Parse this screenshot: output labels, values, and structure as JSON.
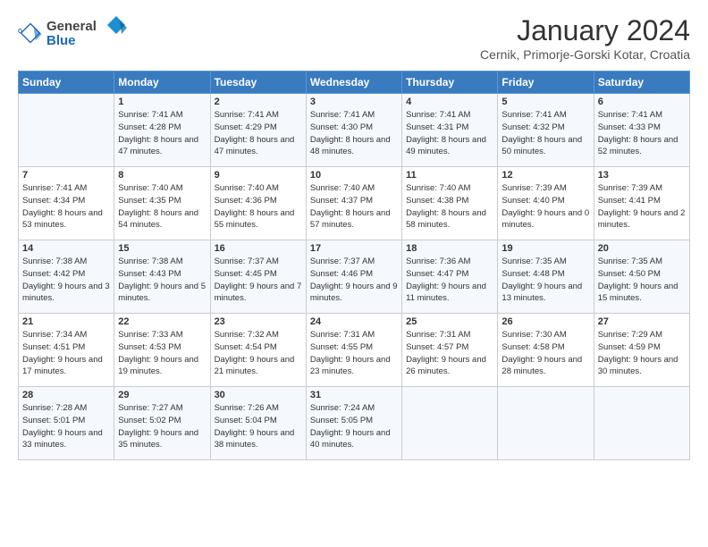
{
  "header": {
    "logo_general": "General",
    "logo_blue": "Blue",
    "title": "January 2024",
    "location": "Cernik, Primorje-Gorski Kotar, Croatia"
  },
  "days_of_week": [
    "Sunday",
    "Monday",
    "Tuesday",
    "Wednesday",
    "Thursday",
    "Friday",
    "Saturday"
  ],
  "weeks": [
    [
      {
        "day": "",
        "sunrise": "",
        "sunset": "",
        "daylight": ""
      },
      {
        "day": "1",
        "sunrise": "Sunrise: 7:41 AM",
        "sunset": "Sunset: 4:28 PM",
        "daylight": "Daylight: 8 hours and 47 minutes."
      },
      {
        "day": "2",
        "sunrise": "Sunrise: 7:41 AM",
        "sunset": "Sunset: 4:29 PM",
        "daylight": "Daylight: 8 hours and 47 minutes."
      },
      {
        "day": "3",
        "sunrise": "Sunrise: 7:41 AM",
        "sunset": "Sunset: 4:30 PM",
        "daylight": "Daylight: 8 hours and 48 minutes."
      },
      {
        "day": "4",
        "sunrise": "Sunrise: 7:41 AM",
        "sunset": "Sunset: 4:31 PM",
        "daylight": "Daylight: 8 hours and 49 minutes."
      },
      {
        "day": "5",
        "sunrise": "Sunrise: 7:41 AM",
        "sunset": "Sunset: 4:32 PM",
        "daylight": "Daylight: 8 hours and 50 minutes."
      },
      {
        "day": "6",
        "sunrise": "Sunrise: 7:41 AM",
        "sunset": "Sunset: 4:33 PM",
        "daylight": "Daylight: 8 hours and 52 minutes."
      }
    ],
    [
      {
        "day": "7",
        "sunrise": "Sunrise: 7:41 AM",
        "sunset": "Sunset: 4:34 PM",
        "daylight": "Daylight: 8 hours and 53 minutes."
      },
      {
        "day": "8",
        "sunrise": "Sunrise: 7:40 AM",
        "sunset": "Sunset: 4:35 PM",
        "daylight": "Daylight: 8 hours and 54 minutes."
      },
      {
        "day": "9",
        "sunrise": "Sunrise: 7:40 AM",
        "sunset": "Sunset: 4:36 PM",
        "daylight": "Daylight: 8 hours and 55 minutes."
      },
      {
        "day": "10",
        "sunrise": "Sunrise: 7:40 AM",
        "sunset": "Sunset: 4:37 PM",
        "daylight": "Daylight: 8 hours and 57 minutes."
      },
      {
        "day": "11",
        "sunrise": "Sunrise: 7:40 AM",
        "sunset": "Sunset: 4:38 PM",
        "daylight": "Daylight: 8 hours and 58 minutes."
      },
      {
        "day": "12",
        "sunrise": "Sunrise: 7:39 AM",
        "sunset": "Sunset: 4:40 PM",
        "daylight": "Daylight: 9 hours and 0 minutes."
      },
      {
        "day": "13",
        "sunrise": "Sunrise: 7:39 AM",
        "sunset": "Sunset: 4:41 PM",
        "daylight": "Daylight: 9 hours and 2 minutes."
      }
    ],
    [
      {
        "day": "14",
        "sunrise": "Sunrise: 7:38 AM",
        "sunset": "Sunset: 4:42 PM",
        "daylight": "Daylight: 9 hours and 3 minutes."
      },
      {
        "day": "15",
        "sunrise": "Sunrise: 7:38 AM",
        "sunset": "Sunset: 4:43 PM",
        "daylight": "Daylight: 9 hours and 5 minutes."
      },
      {
        "day": "16",
        "sunrise": "Sunrise: 7:37 AM",
        "sunset": "Sunset: 4:45 PM",
        "daylight": "Daylight: 9 hours and 7 minutes."
      },
      {
        "day": "17",
        "sunrise": "Sunrise: 7:37 AM",
        "sunset": "Sunset: 4:46 PM",
        "daylight": "Daylight: 9 hours and 9 minutes."
      },
      {
        "day": "18",
        "sunrise": "Sunrise: 7:36 AM",
        "sunset": "Sunset: 4:47 PM",
        "daylight": "Daylight: 9 hours and 11 minutes."
      },
      {
        "day": "19",
        "sunrise": "Sunrise: 7:35 AM",
        "sunset": "Sunset: 4:48 PM",
        "daylight": "Daylight: 9 hours and 13 minutes."
      },
      {
        "day": "20",
        "sunrise": "Sunrise: 7:35 AM",
        "sunset": "Sunset: 4:50 PM",
        "daylight": "Daylight: 9 hours and 15 minutes."
      }
    ],
    [
      {
        "day": "21",
        "sunrise": "Sunrise: 7:34 AM",
        "sunset": "Sunset: 4:51 PM",
        "daylight": "Daylight: 9 hours and 17 minutes."
      },
      {
        "day": "22",
        "sunrise": "Sunrise: 7:33 AM",
        "sunset": "Sunset: 4:53 PM",
        "daylight": "Daylight: 9 hours and 19 minutes."
      },
      {
        "day": "23",
        "sunrise": "Sunrise: 7:32 AM",
        "sunset": "Sunset: 4:54 PM",
        "daylight": "Daylight: 9 hours and 21 minutes."
      },
      {
        "day": "24",
        "sunrise": "Sunrise: 7:31 AM",
        "sunset": "Sunset: 4:55 PM",
        "daylight": "Daylight: 9 hours and 23 minutes."
      },
      {
        "day": "25",
        "sunrise": "Sunrise: 7:31 AM",
        "sunset": "Sunset: 4:57 PM",
        "daylight": "Daylight: 9 hours and 26 minutes."
      },
      {
        "day": "26",
        "sunrise": "Sunrise: 7:30 AM",
        "sunset": "Sunset: 4:58 PM",
        "daylight": "Daylight: 9 hours and 28 minutes."
      },
      {
        "day": "27",
        "sunrise": "Sunrise: 7:29 AM",
        "sunset": "Sunset: 4:59 PM",
        "daylight": "Daylight: 9 hours and 30 minutes."
      }
    ],
    [
      {
        "day": "28",
        "sunrise": "Sunrise: 7:28 AM",
        "sunset": "Sunset: 5:01 PM",
        "daylight": "Daylight: 9 hours and 33 minutes."
      },
      {
        "day": "29",
        "sunrise": "Sunrise: 7:27 AM",
        "sunset": "Sunset: 5:02 PM",
        "daylight": "Daylight: 9 hours and 35 minutes."
      },
      {
        "day": "30",
        "sunrise": "Sunrise: 7:26 AM",
        "sunset": "Sunset: 5:04 PM",
        "daylight": "Daylight: 9 hours and 38 minutes."
      },
      {
        "day": "31",
        "sunrise": "Sunrise: 7:24 AM",
        "sunset": "Sunset: 5:05 PM",
        "daylight": "Daylight: 9 hours and 40 minutes."
      },
      {
        "day": "",
        "sunrise": "",
        "sunset": "",
        "daylight": ""
      },
      {
        "day": "",
        "sunrise": "",
        "sunset": "",
        "daylight": ""
      },
      {
        "day": "",
        "sunrise": "",
        "sunset": "",
        "daylight": ""
      }
    ]
  ]
}
